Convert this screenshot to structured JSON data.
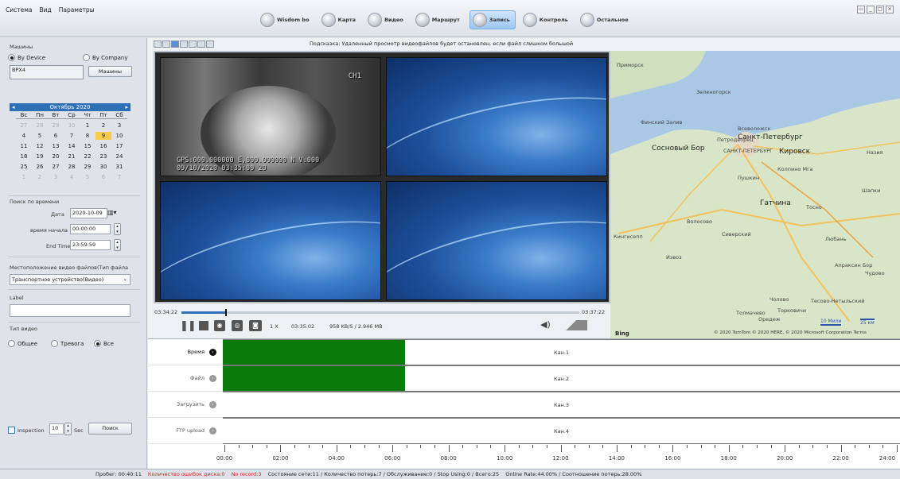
{
  "menu": [
    "Система",
    "Вид",
    "Параметры"
  ],
  "nav": [
    {
      "label": "Wisdom bo",
      "icon": "wisdom-icon",
      "active": false
    },
    {
      "label": "Карта",
      "icon": "map-icon",
      "active": false
    },
    {
      "label": "Видео",
      "icon": "video-icon",
      "active": false
    },
    {
      "label": "Маршрут",
      "icon": "route-icon",
      "active": false
    },
    {
      "label": "Запись",
      "icon": "record-icon",
      "active": true
    },
    {
      "label": "Контроль",
      "icon": "control-icon",
      "active": false
    },
    {
      "label": "Остальное",
      "icon": "other-icon",
      "active": false
    }
  ],
  "left": {
    "machines_label": "Машины",
    "by_device": "By Device",
    "by_company": "By Company",
    "device_value": "BPX4",
    "machines_button": "Машины",
    "calendar_title": "Октябрь 2020",
    "weekdays": [
      "Вс",
      "Пн",
      "Вт",
      "Ср",
      "Чт",
      "Пт",
      "Сб"
    ],
    "days": [
      [
        "27",
        "dim"
      ],
      [
        "28",
        "dim"
      ],
      [
        "29",
        "dim"
      ],
      [
        "30",
        "dim"
      ],
      [
        "1",
        ""
      ],
      [
        "2",
        ""
      ],
      [
        "3",
        ""
      ],
      [
        "4",
        ""
      ],
      [
        "5",
        ""
      ],
      [
        "6",
        ""
      ],
      [
        "7",
        ""
      ],
      [
        "8",
        ""
      ],
      [
        "9",
        "sel"
      ],
      [
        "10",
        ""
      ],
      [
        "11",
        ""
      ],
      [
        "12",
        ""
      ],
      [
        "13",
        ""
      ],
      [
        "14",
        ""
      ],
      [
        "15",
        ""
      ],
      [
        "16",
        ""
      ],
      [
        "17",
        ""
      ],
      [
        "18",
        ""
      ],
      [
        "19",
        ""
      ],
      [
        "20",
        ""
      ],
      [
        "21",
        ""
      ],
      [
        "22",
        ""
      ],
      [
        "23",
        ""
      ],
      [
        "24",
        ""
      ],
      [
        "25",
        ""
      ],
      [
        "26",
        ""
      ],
      [
        "27",
        ""
      ],
      [
        "28",
        ""
      ],
      [
        "29",
        ""
      ],
      [
        "30",
        ""
      ],
      [
        "31",
        ""
      ],
      [
        "1",
        "dim"
      ],
      [
        "2",
        "dim"
      ],
      [
        "3",
        "dim"
      ],
      [
        "4",
        "dim"
      ],
      [
        "5",
        "dim"
      ],
      [
        "6",
        "dim"
      ],
      [
        "7",
        "dim"
      ]
    ],
    "time_search_label": "Поиск по времени",
    "date_label": "Дата",
    "date_value": "2020-10-09",
    "start_label": "время начала",
    "start_value": "00:00:00",
    "end_label": "End Time",
    "end_value": "23:59:59",
    "location_label": "Местоположение видео файлов(Тип файла",
    "location_value": "Транспортное устройство(Видео)",
    "label_label": "Label",
    "label_value": "",
    "video_type_label": "Тип видео",
    "type_general": "Общее",
    "type_alarm": "Тревога",
    "type_all": "Все",
    "inspection_label": "Inspection",
    "inspection_value": "10",
    "sec_label": "Sec",
    "search_button": "Поиск"
  },
  "hint": "Подсказка: Удаленный просмотр видеофайлов будет остановлен, если файл слишком большой",
  "camera": {
    "channel": "CH1",
    "gps": "GPS:000.000000 E,000.000000 N V:000",
    "datetime": "09/10/2020 03:35:00 20"
  },
  "player": {
    "start_time": "03:34:22",
    "end_time": "03:37:22",
    "progress": 0.11,
    "speed": "1 X",
    "current_time": "03:35:02",
    "rate": "958 KB/S / 2.946 MB"
  },
  "map": {
    "labels": [
      "Приморск",
      "Зеленогорск",
      "Финский Залив",
      "Всеволожск",
      "Санкт-Петербург",
      "Петродворец",
      "Сосновый Бор",
      "САНКТ-ПЕТЕРБУРГ",
      "Кировск",
      "Назия",
      "Колпино Мга",
      "Пушкин",
      "Шапки",
      "Гатчина",
      "Тосно",
      "Волосово",
      "Кингисепп",
      "Сиверский",
      "Любань",
      "Извоз",
      "Апраксин Бор",
      "Чудово",
      "Толмачево",
      "Торковичи",
      "Оредеж",
      "Чолово",
      "Тесово-Нетыльский"
    ],
    "bing": "Bing",
    "scale_miles": "10 Мили",
    "scale_km": "25 км",
    "copyright": "© 2020 TomTom © 2020 HERE, © 2020 Microsoft Corporation Terms"
  },
  "timeline": {
    "rows": [
      {
        "label": "Время",
        "channel": "Кан.1",
        "active": true,
        "fill": 0.52
      },
      {
        "label": "Файл",
        "channel": "Кан.2",
        "active": false,
        "fill": 0.52
      },
      {
        "label": "Загрузить",
        "channel": "Кан.3",
        "active": false,
        "fill": 0
      },
      {
        "label": "FTP upload",
        "channel": "Кан.4",
        "active": false,
        "fill": 0
      }
    ],
    "ticks": [
      "00:00",
      "02:00",
      "04:00",
      "06:00",
      "08:00",
      "10:00",
      "12:00",
      "14:00",
      "16:00",
      "18:00",
      "20:00",
      "22:00",
      "24:00"
    ]
  },
  "status": {
    "mileage": "Пробег: 00:40:11",
    "disk_errors": "Количество ошибок диска:0",
    "no_record": "No record:3",
    "net_state": "Состояние сети:11 / Количество потерь:7 / Обслуживание:0 / Stop Using:0 / Всего:25",
    "online_rate": "Online Rate:44.00% / Соотношение потерь:28.00%"
  },
  "colors": {
    "accent": "#2f6fb6",
    "timeline_fill": "#0a7a0a",
    "selected_day": "#f3cd4b",
    "error_text": "#e02020"
  }
}
